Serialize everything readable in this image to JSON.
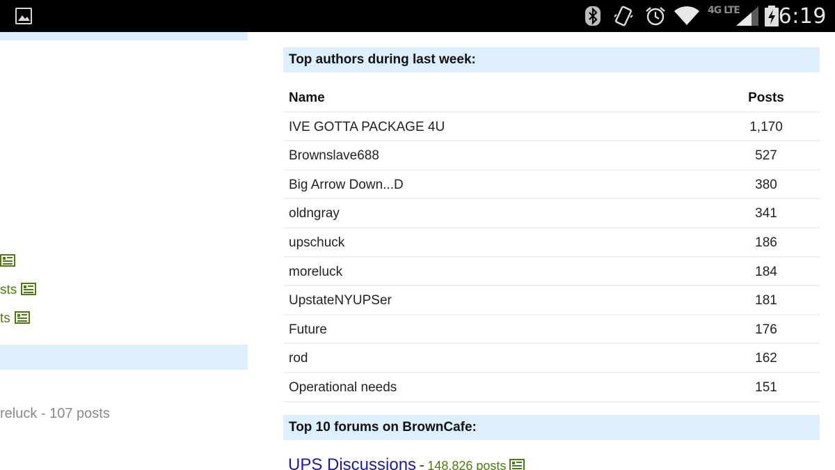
{
  "status_bar": {
    "time": "6:19",
    "network": "4G LTE",
    "icons": [
      "gallery-icon",
      "bluetooth-icon",
      "vibrate-icon",
      "alarm-icon",
      "wifi-icon",
      "signal-icon",
      "battery-charging-icon"
    ]
  },
  "left_column": {
    "links": [
      {
        "text": ""
      },
      {
        "text": "sts"
      },
      {
        "text": "ts"
      }
    ],
    "bottom_text": "reluck - 107 posts"
  },
  "top_authors": {
    "header": "Top authors during last week:",
    "columns": {
      "name": "Name",
      "posts": "Posts"
    },
    "rows": [
      {
        "name": "IVE GOTTA PACKAGE 4U",
        "posts": "1,170"
      },
      {
        "name": "Brownslave688",
        "posts": "527"
      },
      {
        "name": "Big Arrow Down...D",
        "posts": "380"
      },
      {
        "name": "oldngray",
        "posts": "341"
      },
      {
        "name": "upschuck",
        "posts": "186"
      },
      {
        "name": "moreluck",
        "posts": "184"
      },
      {
        "name": "UpstateNYUPSer",
        "posts": "181"
      },
      {
        "name": "Future",
        "posts": "176"
      },
      {
        "name": "rod",
        "posts": "162"
      },
      {
        "name": "Operational needs",
        "posts": "151"
      }
    ]
  },
  "top_forums": {
    "header": "Top 10 forums on BrownCafe:",
    "first_forum": {
      "name": "UPS Discussions",
      "separator": "-",
      "count": "148,826 posts"
    }
  },
  "colors": {
    "status_bar_bg": "#000000",
    "section_header_bg": "#ddeefc",
    "row_divider": "#e9f1f9",
    "post_count_green": "#4e7a14",
    "link_blue": "#1a1aa6"
  }
}
